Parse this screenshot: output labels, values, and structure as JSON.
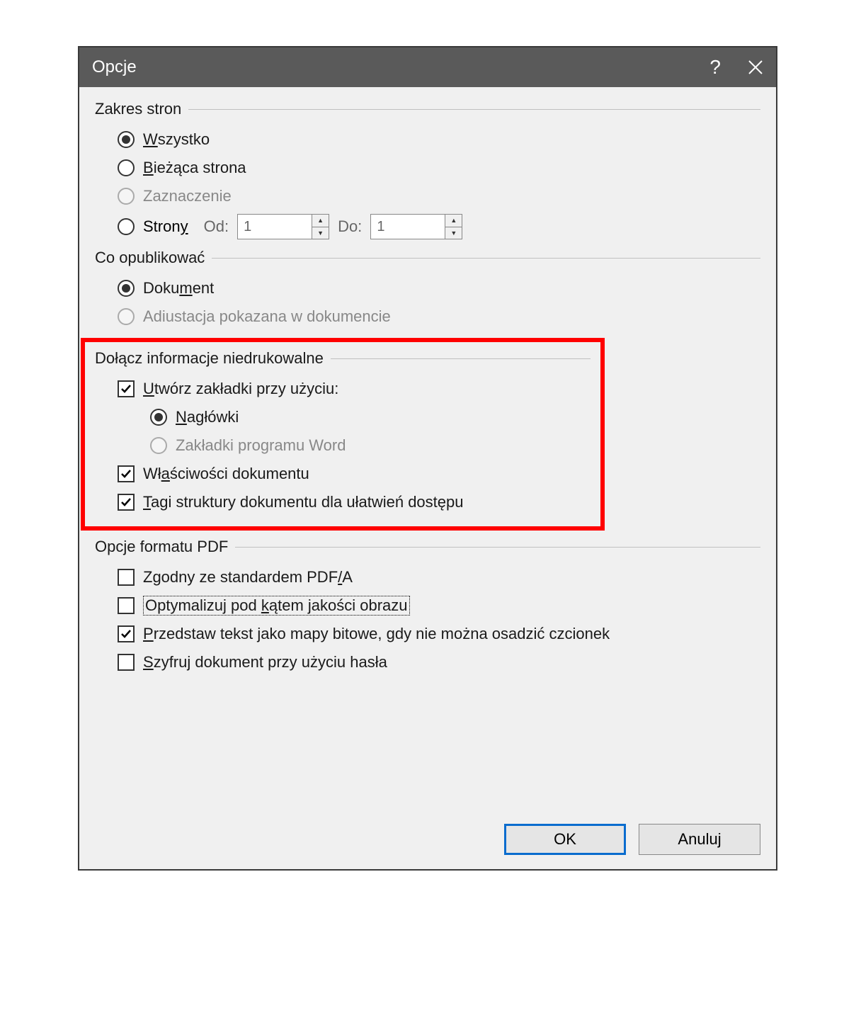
{
  "titlebar": {
    "title": "Opcje"
  },
  "groups": {
    "pageRange": {
      "label": "Zakres stron",
      "all": {
        "pre": "",
        "u": "W",
        "post": "szystko"
      },
      "current": {
        "pre": "",
        "u": "B",
        "post": "ieżąca strona"
      },
      "selection": "Zaznaczenie",
      "pages": {
        "pre": "Stron",
        "u": "y",
        "post": ""
      },
      "from": "Od:",
      "to": "Do:",
      "fromValue": "1",
      "toValue": "1"
    },
    "publish": {
      "label": "Co opublikować",
      "document": {
        "pre": "Doku",
        "u": "m",
        "post": "ent"
      },
      "markup": "Adiustacja pokazana w dokumencie"
    },
    "nonPrint": {
      "label": "Dołącz informacje niedrukowalne",
      "bookmarks": {
        "pre": "",
        "u": "U",
        "post": "twórz zakładki przy użyciu:"
      },
      "headings": {
        "pre": "",
        "u": "N",
        "post": "agłówki"
      },
      "wordBookmarks": "Zakładki programu Word",
      "docProps": {
        "pre": "Wł",
        "u": "a",
        "post": "ściwości dokumentu"
      },
      "tags": {
        "pre": "",
        "u": "T",
        "post": "agi struktury dokumentu dla ułatwień dostępu"
      }
    },
    "pdfFormat": {
      "label": "Opcje formatu PDF",
      "pdfa": {
        "pre": "Zgodny ze standardem PDF",
        "u": "/",
        "post": "A"
      },
      "optimize": {
        "pre": "Optymalizuj pod ",
        "u": "k",
        "post": "ątem jakości obrazu"
      },
      "bitmap": {
        "pre": "",
        "u": "P",
        "post": "rzedstaw tekst jako mapy bitowe, gdy nie można osadzić czcionek"
      },
      "encrypt": {
        "pre": "",
        "u": "S",
        "post": "zyfruj dokument przy użyciu hasła"
      }
    }
  },
  "buttons": {
    "ok": "OK",
    "cancel": "Anuluj"
  }
}
